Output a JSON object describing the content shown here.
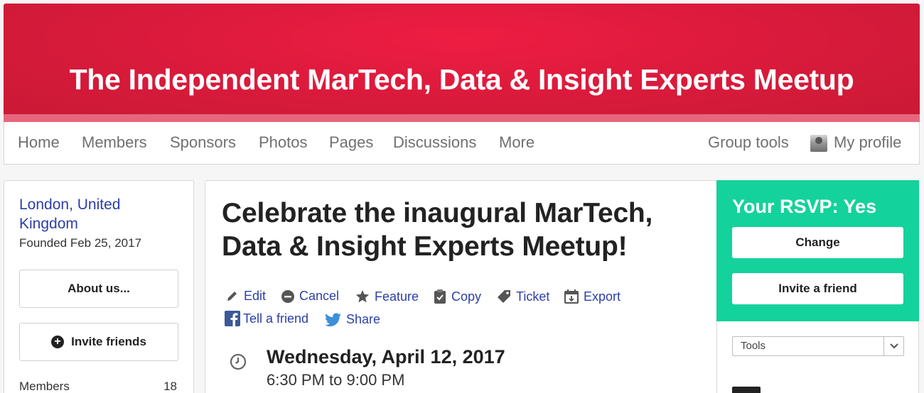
{
  "banner": {
    "title": "The Independent MarTech, Data & Insight Experts Meetup"
  },
  "nav": {
    "items": [
      "Home",
      "Members",
      "Sponsors",
      "Photos",
      "Pages",
      "Discussions",
      "More"
    ],
    "group_tools": "Group tools",
    "my_profile": "My profile"
  },
  "sidebar": {
    "location": "London, United Kingdom",
    "founded": "Founded Feb 25, 2017",
    "about_button": "About us...",
    "invite_button": "Invite friends",
    "members_label": "Members",
    "members_count": "18"
  },
  "event": {
    "title": "Celebrate the inaugural MarTech, Data & Insight Experts Meetup!",
    "actions": {
      "edit": "Edit",
      "cancel": "Cancel",
      "feature": "Feature",
      "copy": "Copy",
      "ticket": "Ticket",
      "export": "Export",
      "tell_a_friend": "Tell a friend",
      "share": "Share"
    },
    "date": "Wednesday, April 12, 2017",
    "time": "6:30 PM to 9:00 PM"
  },
  "rsvp": {
    "title": "Your RSVP: Yes",
    "change_button": "Change",
    "invite_button": "Invite a friend"
  },
  "tools": {
    "selected": "Tools"
  },
  "colors": {
    "banner": "#d81a3b",
    "rsvp_green": "#14d29b",
    "link_blue": "#2c3fa8"
  }
}
